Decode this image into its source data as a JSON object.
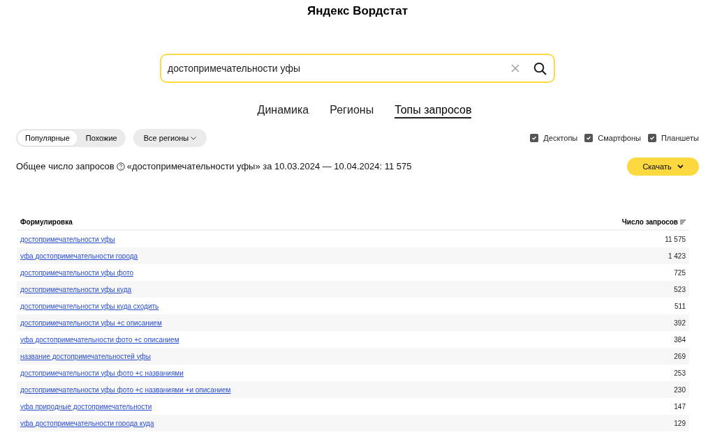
{
  "title": "Яндекс Вордстат",
  "search": {
    "value": "достопримечательности уфы"
  },
  "tabs": [
    {
      "label": "Динамика",
      "selected": false
    },
    {
      "label": "Регионы",
      "selected": false
    },
    {
      "label": "Топы запросов",
      "selected": true
    }
  ],
  "mode": [
    {
      "label": "Популярные",
      "selected": true
    },
    {
      "label": "Похожие",
      "selected": false
    }
  ],
  "region_dropdown": "Все регионы",
  "devices": [
    {
      "label": "Десктопы",
      "checked": true
    },
    {
      "label": "Смартфоны",
      "checked": true
    },
    {
      "label": "Планшеты",
      "checked": true
    }
  ],
  "summary": {
    "label": "Общее число запросов",
    "text": "«достопримечательности уфы» за 10.03.2024 — 10.04.2024: 11 575"
  },
  "download_button": "Скачать",
  "table": {
    "columns": [
      "Формулировка",
      "Число запросов"
    ],
    "rows": [
      {
        "phrase": "достопримечательности уфы",
        "count": "11 575"
      },
      {
        "phrase": "уфа достопримечательности города",
        "count": "1 423"
      },
      {
        "phrase": "достопримечательности уфы фото",
        "count": "725"
      },
      {
        "phrase": "достопримечательности уфы куда",
        "count": "523"
      },
      {
        "phrase": "достопримечательности уфы куда сходить",
        "count": "511"
      },
      {
        "phrase": "достопримечательности уфы +с описанием",
        "count": "392"
      },
      {
        "phrase": "уфа достопримечательности фото +с описанием",
        "count": "384"
      },
      {
        "phrase": "название достопримечательностей уфы",
        "count": "269"
      },
      {
        "phrase": "достопримечательности уфы фото +с названиями",
        "count": "253"
      },
      {
        "phrase": "достопримечательности уфы фото +с названиями +и описанием",
        "count": "230"
      },
      {
        "phrase": "уфа природные достопримечательности",
        "count": "147"
      },
      {
        "phrase": "уфа достопримечательности города куда",
        "count": "129"
      }
    ]
  }
}
